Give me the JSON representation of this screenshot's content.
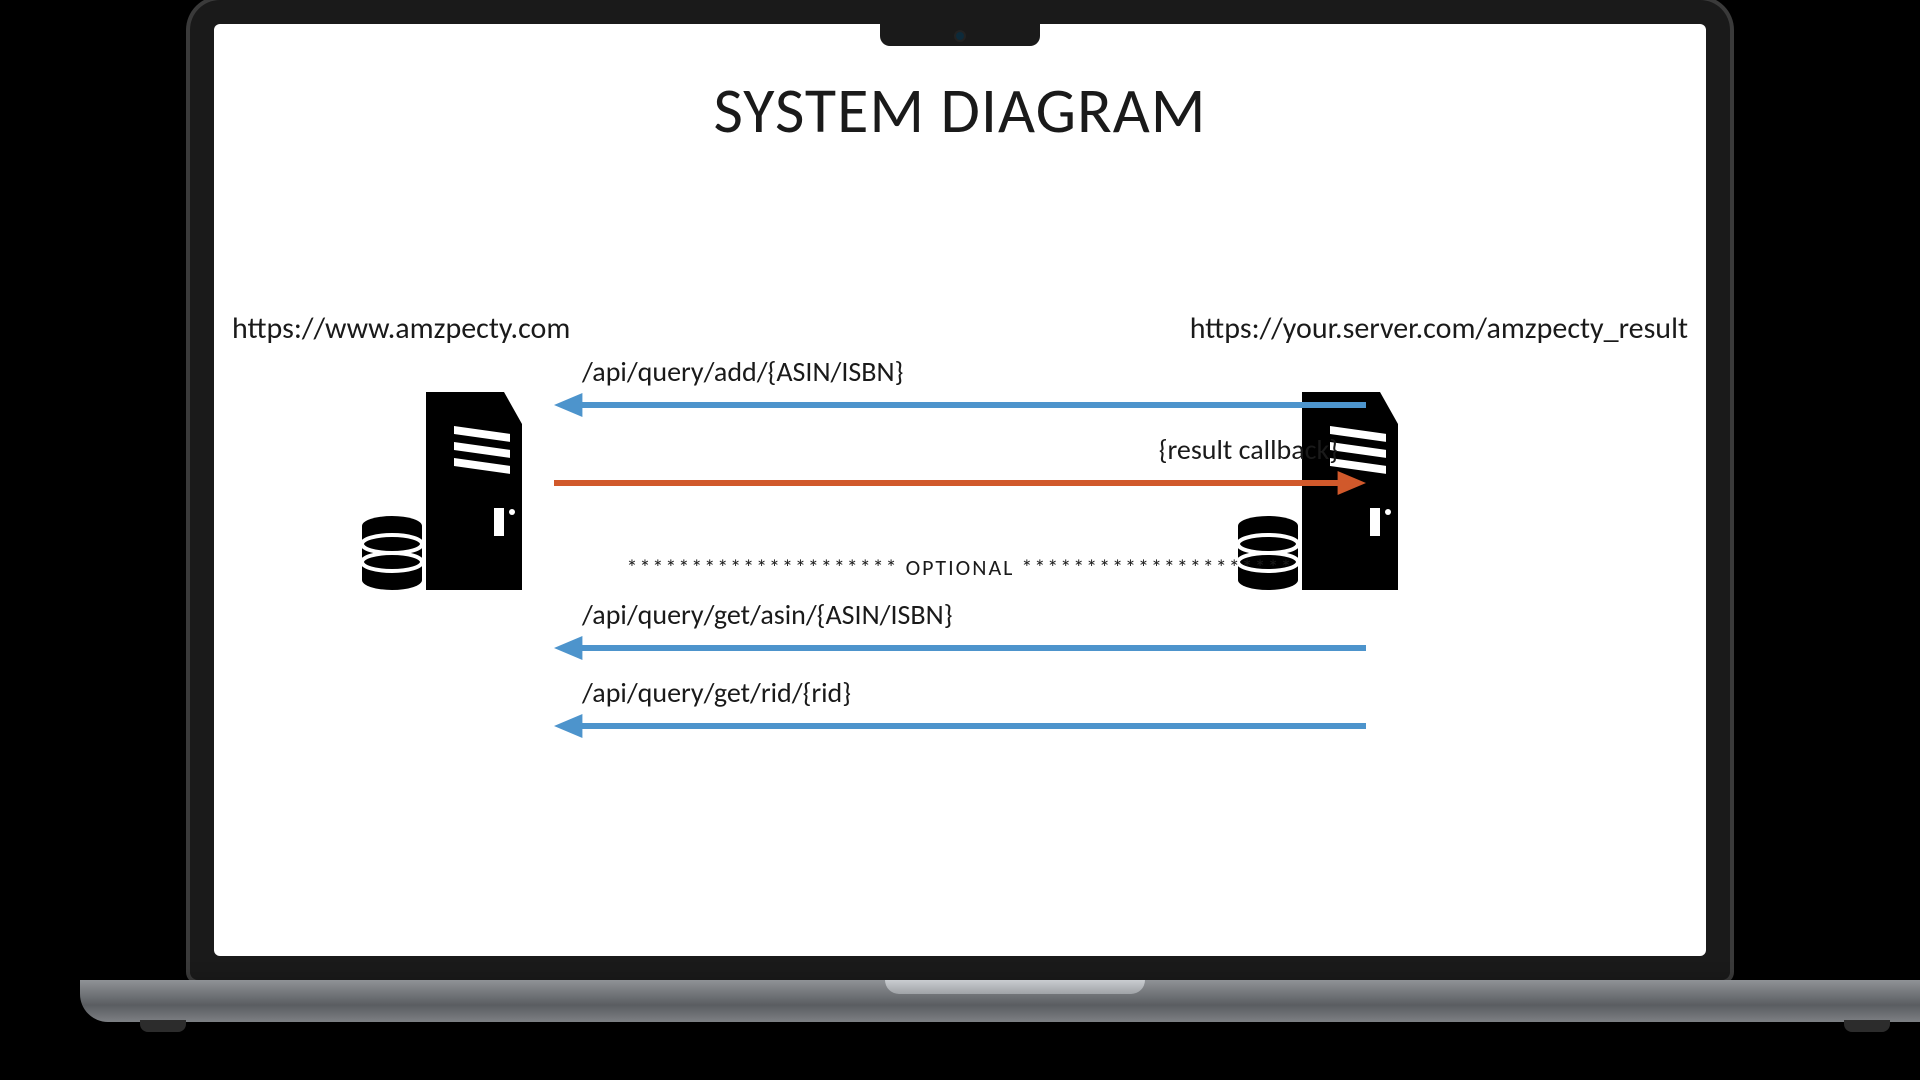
{
  "title": "SYSTEM DIAGRAM",
  "left_server_url": "https://www.amzpecty.com",
  "right_server_url": "https://your.server.com/amzpecty_result",
  "flows": {
    "add": "/api/query/add/{ASIN/ISBN}",
    "callback": "{result callback}",
    "get_asin": "/api/query/get/asin/{ASIN/ISBN}",
    "get_rid": "/api/query/get/rid/{rid}"
  },
  "optional_divider": "********************* OPTIONAL *********************",
  "colors": {
    "arrow_blue": "#4d94cc",
    "arrow_orange": "#d1592b"
  }
}
